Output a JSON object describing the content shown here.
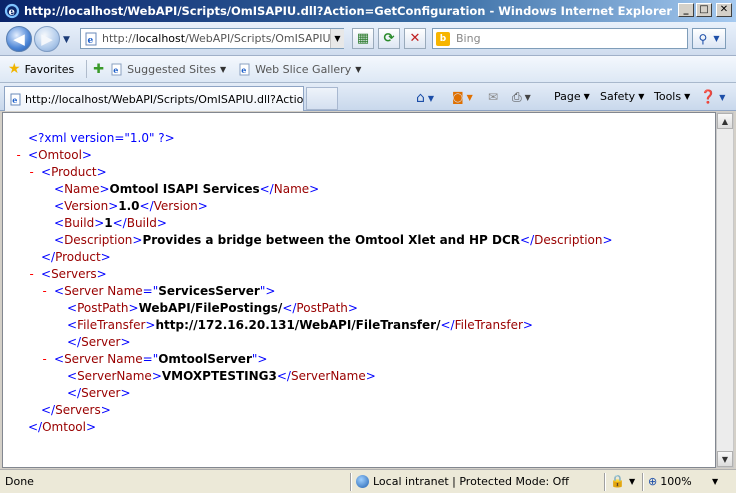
{
  "window": {
    "title": "http://localhost/WebAPI/Scripts/OmISAPIU.dll?Action=GetConfiguration - Windows Internet Explorer"
  },
  "address": {
    "prefix": "http://",
    "host": "localhost",
    "path": "/WebAPI/Scripts/OmISAPIU.dll?"
  },
  "search": {
    "placeholder": "Bing"
  },
  "favorites": {
    "label": "Favorites",
    "links": [
      "Suggested Sites",
      "Web Slice Gallery"
    ]
  },
  "tab": {
    "title": "http://localhost/WebAPI/Scripts/OmISAPIU.dll?Action..."
  },
  "commands": {
    "page": "Page",
    "safety": "Safety",
    "tools": "Tools"
  },
  "xml": {
    "declaration": "<?xml version=\"1.0\" ?>",
    "root_tag": "Omtool",
    "product_tag": "Product",
    "product": {
      "name_tag": "Name",
      "name": "Omtool ISAPI Services",
      "version_tag": "Version",
      "version": "1.0",
      "build_tag": "Build",
      "build": "1",
      "description_tag": "Description",
      "description": "Provides a bridge between the Omtool Xlet and HP DCR"
    },
    "servers_tag": "Servers",
    "server_tag": "Server",
    "attr_name": "Name",
    "server1": {
      "name": "ServicesServer",
      "postpath_tag": "PostPath",
      "postpath": "WebAPI/FilePostings/",
      "filetransfer_tag": "FileTransfer",
      "filetransfer": "http://172.16.20.131/WebAPI/FileTransfer/"
    },
    "server2": {
      "name": "OmtoolServer",
      "servername_tag": "ServerName",
      "servername": "VMOXPTESTING3"
    }
  },
  "status": {
    "text": "Done",
    "zone": "Local intranet | Protected Mode: Off",
    "zoom": "100%"
  }
}
